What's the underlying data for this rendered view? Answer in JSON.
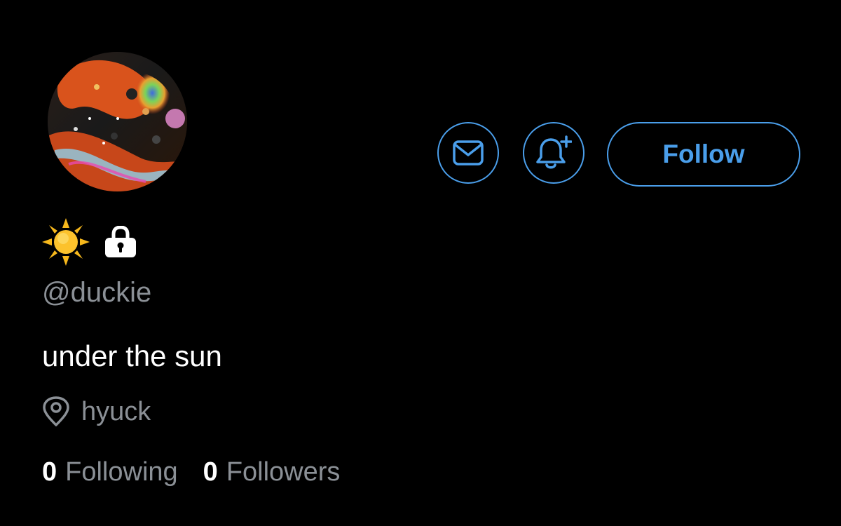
{
  "profile": {
    "name_emoji": "sun-emoji",
    "locked_icon": "lock-icon",
    "handle": "@duckie",
    "bio": "under the sun",
    "location": "hyuck",
    "following_count": "0",
    "following_label": "Following",
    "followers_count": "0",
    "followers_label": "Followers"
  },
  "actions": {
    "message_icon": "envelope-icon",
    "notify_icon": "bell-plus-icon",
    "follow_label": "Follow"
  },
  "colors": {
    "background": "#000000",
    "accent": "#4a9eea",
    "text_primary": "#ffffff",
    "text_secondary": "#8b9096"
  }
}
